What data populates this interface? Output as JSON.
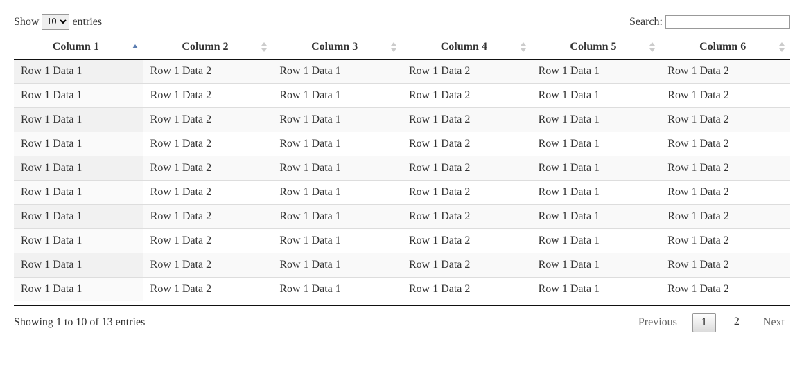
{
  "length": {
    "show": "Show",
    "entries": "entries",
    "value": "10"
  },
  "search": {
    "label": "Search:",
    "value": ""
  },
  "columns": [
    "Column 1",
    "Column 2",
    "Column 3",
    "Column 4",
    "Column 5",
    "Column 6"
  ],
  "sorted_column_index": 0,
  "sorted_direction": "asc",
  "rows": [
    [
      "Row 1 Data 1",
      "Row 1 Data 2",
      "Row 1 Data 1",
      "Row 1 Data 2",
      "Row 1 Data 1",
      "Row 1 Data 2"
    ],
    [
      "Row 1 Data 1",
      "Row 1 Data 2",
      "Row 1 Data 1",
      "Row 1 Data 2",
      "Row 1 Data 1",
      "Row 1 Data 2"
    ],
    [
      "Row 1 Data 1",
      "Row 1 Data 2",
      "Row 1 Data 1",
      "Row 1 Data 2",
      "Row 1 Data 1",
      "Row 1 Data 2"
    ],
    [
      "Row 1 Data 1",
      "Row 1 Data 2",
      "Row 1 Data 1",
      "Row 1 Data 2",
      "Row 1 Data 1",
      "Row 1 Data 2"
    ],
    [
      "Row 1 Data 1",
      "Row 1 Data 2",
      "Row 1 Data 1",
      "Row 1 Data 2",
      "Row 1 Data 1",
      "Row 1 Data 2"
    ],
    [
      "Row 1 Data 1",
      "Row 1 Data 2",
      "Row 1 Data 1",
      "Row 1 Data 2",
      "Row 1 Data 1",
      "Row 1 Data 2"
    ],
    [
      "Row 1 Data 1",
      "Row 1 Data 2",
      "Row 1 Data 1",
      "Row 1 Data 2",
      "Row 1 Data 1",
      "Row 1 Data 2"
    ],
    [
      "Row 1 Data 1",
      "Row 1 Data 2",
      "Row 1 Data 1",
      "Row 1 Data 2",
      "Row 1 Data 1",
      "Row 1 Data 2"
    ],
    [
      "Row 1 Data 1",
      "Row 1 Data 2",
      "Row 1 Data 1",
      "Row 1 Data 2",
      "Row 1 Data 1",
      "Row 1 Data 2"
    ],
    [
      "Row 1 Data 1",
      "Row 1 Data 2",
      "Row 1 Data 1",
      "Row 1 Data 2",
      "Row 1 Data 1",
      "Row 1 Data 2"
    ]
  ],
  "info": "Showing 1 to 10 of 13 entries",
  "paginate": {
    "previous": "Previous",
    "next": "Next",
    "pages": [
      "1",
      "2"
    ],
    "current": "1"
  }
}
